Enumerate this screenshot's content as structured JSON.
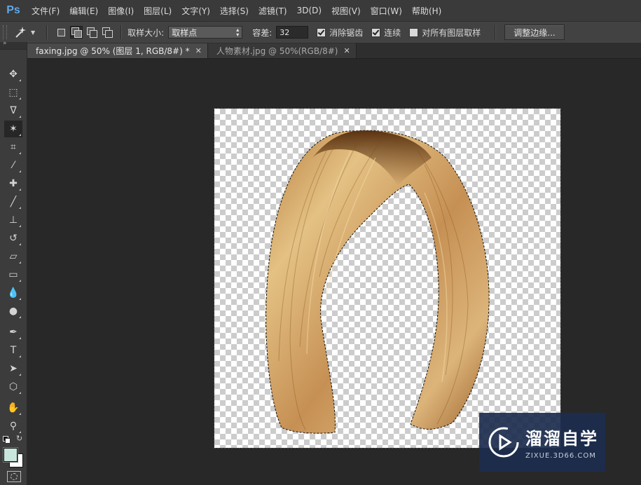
{
  "app": {
    "logo": "Ps"
  },
  "menu": {
    "items": [
      "文件(F)",
      "编辑(E)",
      "图像(I)",
      "图层(L)",
      "文字(Y)",
      "选择(S)",
      "滤镜(T)",
      "3D(D)",
      "视图(V)",
      "窗口(W)",
      "帮助(H)"
    ]
  },
  "options": {
    "sample_size_label": "取样大小:",
    "sample_size_value": "取样点",
    "tolerance_label": "容差:",
    "tolerance_value": "32",
    "antialias_label": "消除锯齿",
    "contiguous_label": "连续",
    "all_layers_label": "对所有图层取样",
    "refine_edge_label": "调整边缘...",
    "antialias_checked": true,
    "contiguous_checked": true,
    "all_layers_checked": false
  },
  "tabs": [
    {
      "label": "faxing.jpg @ 50% (图层 1, RGB/8#) *",
      "active": true
    },
    {
      "label": "人物素材.jpg @ 50%(RGB/8#)",
      "active": false
    }
  ],
  "tools": [
    {
      "name": "move-tool-icon",
      "glyph": "✥"
    },
    {
      "name": "marquee-tool-icon",
      "glyph": "⬚"
    },
    {
      "name": "lasso-tool-icon",
      "glyph": "ᐁ"
    },
    {
      "name": "magic-wand-tool-icon",
      "glyph": "✶"
    },
    {
      "name": "crop-tool-icon",
      "glyph": "⌗"
    },
    {
      "name": "eyedropper-tool-icon",
      "glyph": "⁄"
    },
    {
      "name": "healing-brush-tool-icon",
      "glyph": "✚"
    },
    {
      "name": "brush-tool-icon",
      "glyph": "╱"
    },
    {
      "name": "clone-stamp-tool-icon",
      "glyph": "⊥"
    },
    {
      "name": "history-brush-tool-icon",
      "glyph": "↺"
    },
    {
      "name": "eraser-tool-icon",
      "glyph": "▱"
    },
    {
      "name": "gradient-tool-icon",
      "glyph": "▭"
    },
    {
      "name": "blur-tool-icon",
      "glyph": "💧"
    },
    {
      "name": "dodge-tool-icon",
      "glyph": "●"
    },
    {
      "name": "pen-tool-icon",
      "glyph": "✒"
    },
    {
      "name": "type-tool-icon",
      "glyph": "T"
    },
    {
      "name": "path-selection-tool-icon",
      "glyph": "➤"
    },
    {
      "name": "shape-tool-icon",
      "glyph": "⬡"
    },
    {
      "name": "hand-tool-icon",
      "glyph": "✋"
    },
    {
      "name": "zoom-tool-icon",
      "glyph": "⚲"
    }
  ],
  "colors": {
    "foreground": "#c8e6dc",
    "background": "#ffffff",
    "ps_blue": "#5fa8e8",
    "hair_light": "#e4c184",
    "hair_dark": "#8a5420"
  },
  "watermark": {
    "title": "溜溜自学",
    "subtitle": "ZIXUE.3D66.COM"
  }
}
